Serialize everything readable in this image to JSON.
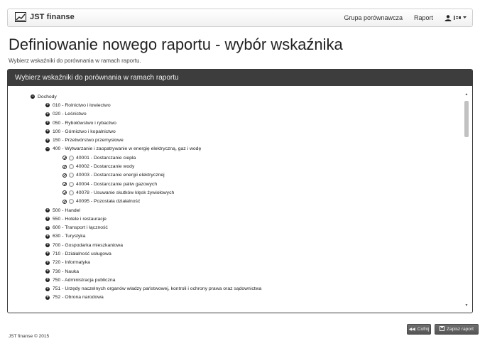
{
  "app": {
    "brand": "JST finanse"
  },
  "nav": {
    "links": [
      "Grupa porównawcza",
      "Raport"
    ]
  },
  "page": {
    "title": "Definiowanie nowego raportu - wybór wskaźnika",
    "subtitle": "Wybierz wskaźniki do porównania w ramach raportu."
  },
  "panel": {
    "heading": "Wybierz wskaźniki do porównania w ramach raportu",
    "tree": [
      {
        "level": 0,
        "toggle": "minus",
        "label": "Dochody"
      },
      {
        "level": 1,
        "toggle": "plus",
        "label": "010 - Rolnictwo i łowiectwo"
      },
      {
        "level": 1,
        "toggle": "plus",
        "label": "020 - Leśnictwo"
      },
      {
        "level": 1,
        "toggle": "plus",
        "label": "050 - Rybołówstwo i rybactwo"
      },
      {
        "level": 1,
        "toggle": "plus",
        "label": "100 - Górnictwo i kopalnictwo"
      },
      {
        "level": 1,
        "toggle": "plus",
        "label": "150 - Przetwórstwo przemysłowe"
      },
      {
        "level": 1,
        "toggle": "minus",
        "label": "400 - Wytwarzanie i zaopatrywanie w energię elektryczną, gaz i wodę"
      },
      {
        "level": 2,
        "toggle": "leaf",
        "label": "40001 - Dostarczanie ciepła"
      },
      {
        "level": 2,
        "toggle": "leaf",
        "label": "40002 - Dostarczanie wody"
      },
      {
        "level": 2,
        "toggle": "leaf",
        "label": "40003 - Dostarczanie energii elektrycznej"
      },
      {
        "level": 2,
        "toggle": "leaf",
        "label": "40004 - Dostarczanie paliw gazowych"
      },
      {
        "level": 2,
        "toggle": "leaf",
        "label": "40078 - Usuwanie skutków klęsk żywiołowych"
      },
      {
        "level": 2,
        "toggle": "leaf",
        "label": "40095 - Pozostała działalność"
      },
      {
        "level": 1,
        "toggle": "plus",
        "label": "500 - Handel"
      },
      {
        "level": 1,
        "toggle": "plus",
        "label": "550 - Hotele i restauracje"
      },
      {
        "level": 1,
        "toggle": "plus",
        "label": "600 - Transport i łączność"
      },
      {
        "level": 1,
        "toggle": "plus",
        "label": "630 - Turystyka"
      },
      {
        "level": 1,
        "toggle": "plus",
        "label": "700 - Gospodarka mieszkaniowa"
      },
      {
        "level": 1,
        "toggle": "plus",
        "label": "710 - Działalność usługowa"
      },
      {
        "level": 1,
        "toggle": "plus",
        "label": "720 - Informatyka"
      },
      {
        "level": 1,
        "toggle": "plus",
        "label": "730 - Nauka"
      },
      {
        "level": 1,
        "toggle": "plus",
        "label": "750 - Administracja publiczna"
      },
      {
        "level": 1,
        "toggle": "plus",
        "label": "751 - Urzędy naczelnych organów władzy państwowej, kontroli i ochrony prawa oraz sądownictwa"
      },
      {
        "level": 1,
        "toggle": "plus",
        "label": "752 - Obrona narodowa"
      }
    ]
  },
  "actions": {
    "back_label": "Cofnij",
    "save_label": "Zapisz raport"
  },
  "footer": {
    "text": "JST finanse © 2015"
  },
  "icons": {
    "brand": "chart-icon",
    "user": "user-icon",
    "back": "backward-icon",
    "save": "floppy-icon",
    "expanded": "minus-circle-icon",
    "collapsed": "plus-circle-icon",
    "leaf": "ban-icon"
  }
}
